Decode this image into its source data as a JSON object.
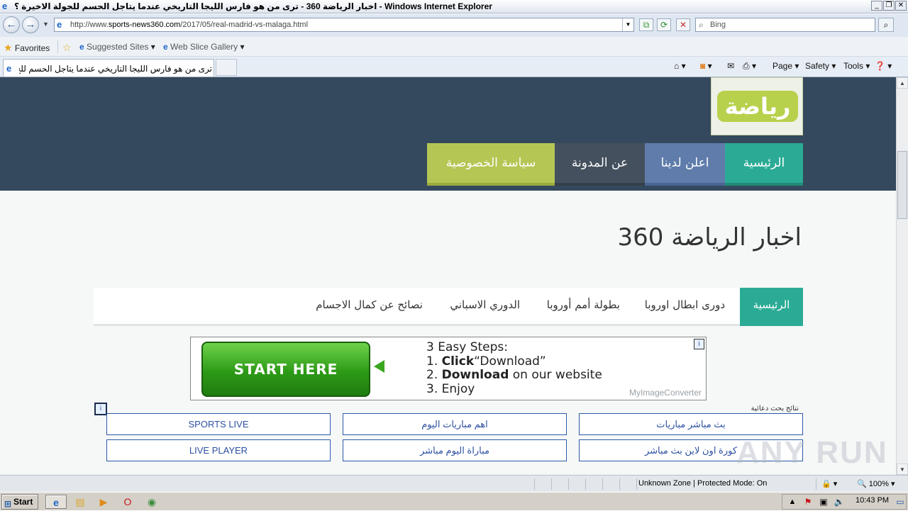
{
  "browser": {
    "window_title": "اخبار الرياضة 360 - ترى من هو فارس الليجا التاريخي عندما يتاجل الحسم للجولة الاخيرة ؟ - Windows Internet Explorer",
    "url_prefix": "http://www.",
    "url_domain": "sports-news360.com",
    "url_path": "/2017/05/real-madrid-vs-malaga.html",
    "search_placeholder": "Bing",
    "favorites_label": "Favorites",
    "suggested_sites_label": "Suggested Sites",
    "web_slice_label": "Web Slice Gallery",
    "tab_title": "ترى من هو فارس الليجا التاريخي عندما يتاجل الحسم للج...",
    "cmd_page": "Page",
    "cmd_safety": "Safety",
    "cmd_tools": "Tools"
  },
  "site": {
    "logo_text": "رياضة",
    "main_nav": [
      "الرئيسية",
      "اعلن لدينا",
      "عن المدونة",
      "سياسة الخصوصية"
    ],
    "title": "اخبار الرياضة 360",
    "category_nav": [
      "الرئيسية",
      "دورى ابطال اوروبا",
      "بطولة أمم أوروبا",
      "الدوري الاسباني",
      "نصائح عن كمال الاجسام"
    ]
  },
  "ad": {
    "button_label": "START HERE",
    "steps_title": "3 Easy Steps:",
    "step1_bold": "Click",
    "step1_rest": "“Download”",
    "step2_bold": "Download",
    "step2_rest": " on our website",
    "step3": "Enjoy",
    "brand": "MyImageConverter",
    "info": "i"
  },
  "ad_links": {
    "label": "نتائج بحث دعائية",
    "info": "i",
    "items": [
      "بث مباشر مباريات",
      "اهم مباريات اليوم",
      "SPORTS LIVE",
      "كورة اون لاين بث مباشر",
      "مباراة اليوم مباشر",
      "LIVE PLAYER"
    ]
  },
  "watermark": "ANY RUN",
  "status": {
    "zone": "Unknown Zone | Protected Mode: On",
    "zoom": "100%"
  },
  "taskbar": {
    "start_label": "Start",
    "clock": "10:43 PM"
  },
  "colors": {
    "header_bg": "#34495e",
    "nav_home": "#2bab95",
    "nav_advertise": "#5f7caa",
    "nav_about": "#44505d",
    "nav_privacy": "#b5c654"
  }
}
